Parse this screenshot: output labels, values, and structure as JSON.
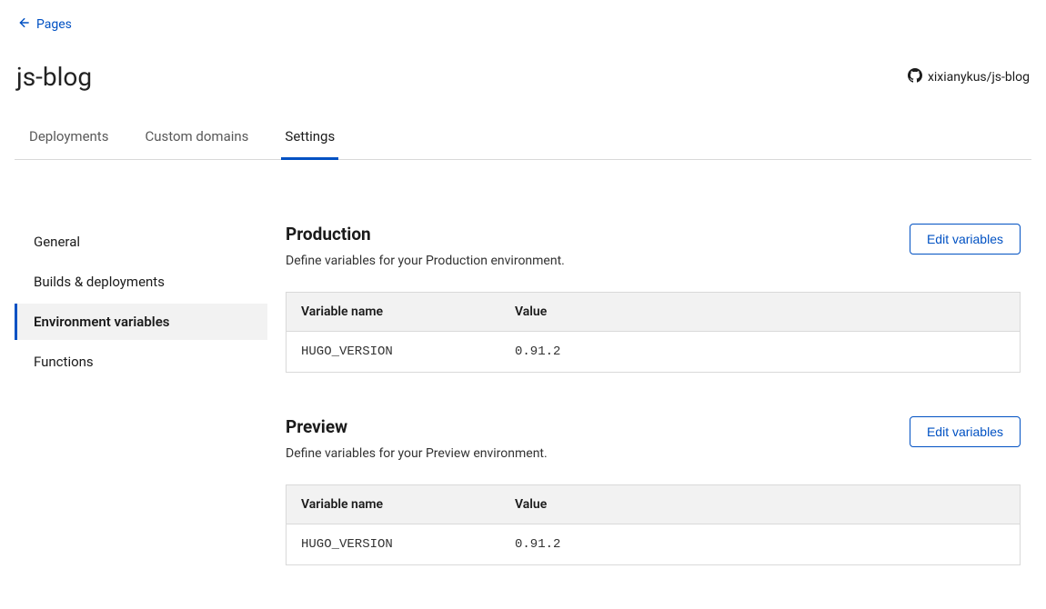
{
  "back": {
    "label": "Pages"
  },
  "header": {
    "title": "js-blog",
    "repo": "xixianykus/js-blog"
  },
  "tabs": [
    {
      "label": "Deployments",
      "active": false
    },
    {
      "label": "Custom domains",
      "active": false
    },
    {
      "label": "Settings",
      "active": true
    }
  ],
  "sidebar": {
    "items": [
      {
        "label": "General",
        "active": false
      },
      {
        "label": "Builds & deployments",
        "active": false
      },
      {
        "label": "Environment variables",
        "active": true
      },
      {
        "label": "Functions",
        "active": false
      }
    ]
  },
  "sections": {
    "production": {
      "title": "Production",
      "description": "Define variables for your Production environment.",
      "button": "Edit variables",
      "columns": {
        "name": "Variable name",
        "value": "Value"
      },
      "rows": [
        {
          "name": "HUGO_VERSION",
          "value": "0.91.2"
        }
      ]
    },
    "preview": {
      "title": "Preview",
      "description": "Define variables for your Preview environment.",
      "button": "Edit variables",
      "columns": {
        "name": "Variable name",
        "value": "Value"
      },
      "rows": [
        {
          "name": "HUGO_VERSION",
          "value": "0.91.2"
        }
      ]
    }
  }
}
